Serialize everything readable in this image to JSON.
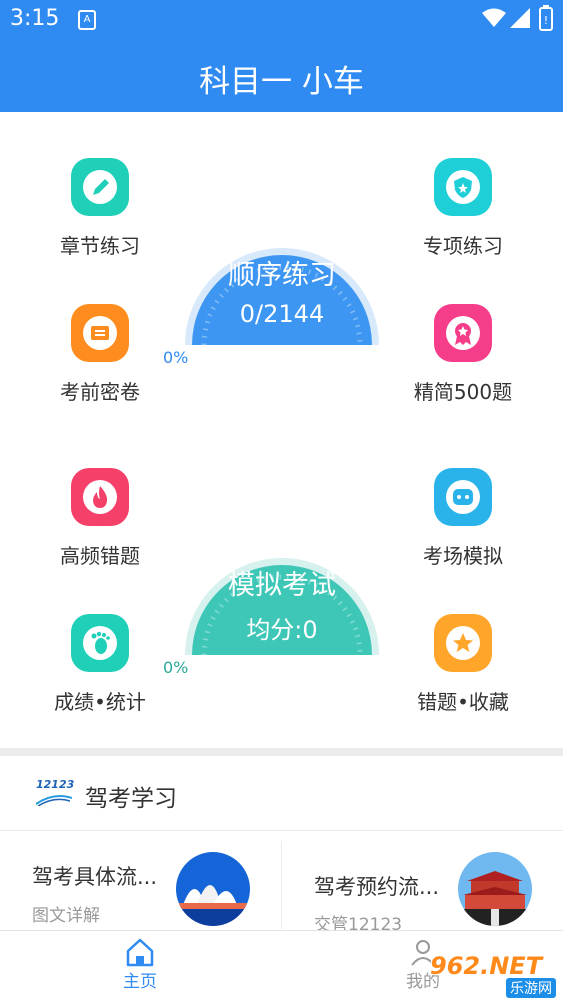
{
  "status_bar": {
    "time": "3:15"
  },
  "app_bar": {
    "title": "科目一 小车"
  },
  "sequential_gauge": {
    "title": "顺序练习",
    "progress": "0/2144",
    "percent": "0%",
    "fill_percent": 0
  },
  "mock_gauge": {
    "title": "模拟考试",
    "score": "均分:0",
    "percent": "0%",
    "fill_percent": 0
  },
  "tiles": {
    "chapter": {
      "label": "章节练习",
      "icon": "pencil-icon",
      "color": "#1fcfb7"
    },
    "special": {
      "label": "专项练习",
      "icon": "shield-star-icon",
      "color": "#1fcfd7"
    },
    "pre_exam": {
      "label": "考前密卷",
      "icon": "ticket-icon",
      "color": "#ff8c1e"
    },
    "simplified": {
      "label": "精简500题",
      "icon": "award-ribbon-icon",
      "color": "#f53d8a"
    },
    "high_freq": {
      "label": "高频错题",
      "icon": "fire-icon",
      "color": "#f5406a"
    },
    "exam_sim": {
      "label": "考场模拟",
      "icon": "chat-bubble-icon",
      "color": "#29b3ea"
    },
    "stats": {
      "label": "成绩•统计",
      "icon": "footprint-icon",
      "color": "#1fcfb7"
    },
    "favorites": {
      "label": "错题•收藏",
      "icon": "star-icon",
      "color": "#ffa52a"
    }
  },
  "study_section": {
    "logo_text": "12123",
    "title": "驾考学习"
  },
  "cards": [
    {
      "title": "驾考具体流...",
      "subtitle": "图文详解",
      "image": "opera-house-icon"
    },
    {
      "title": "驾考预约流...",
      "subtitle": "交管12123",
      "image": "tiananmen-icon"
    }
  ],
  "bottom_nav": {
    "home": "主页",
    "mine": "我的"
  },
  "watermark": {
    "text": "962.NET",
    "sub": "乐游网"
  },
  "colors": {
    "primary": "#2f8bf2",
    "teal": "#3ec7b7",
    "blue_gauge": "#3d97f2"
  }
}
